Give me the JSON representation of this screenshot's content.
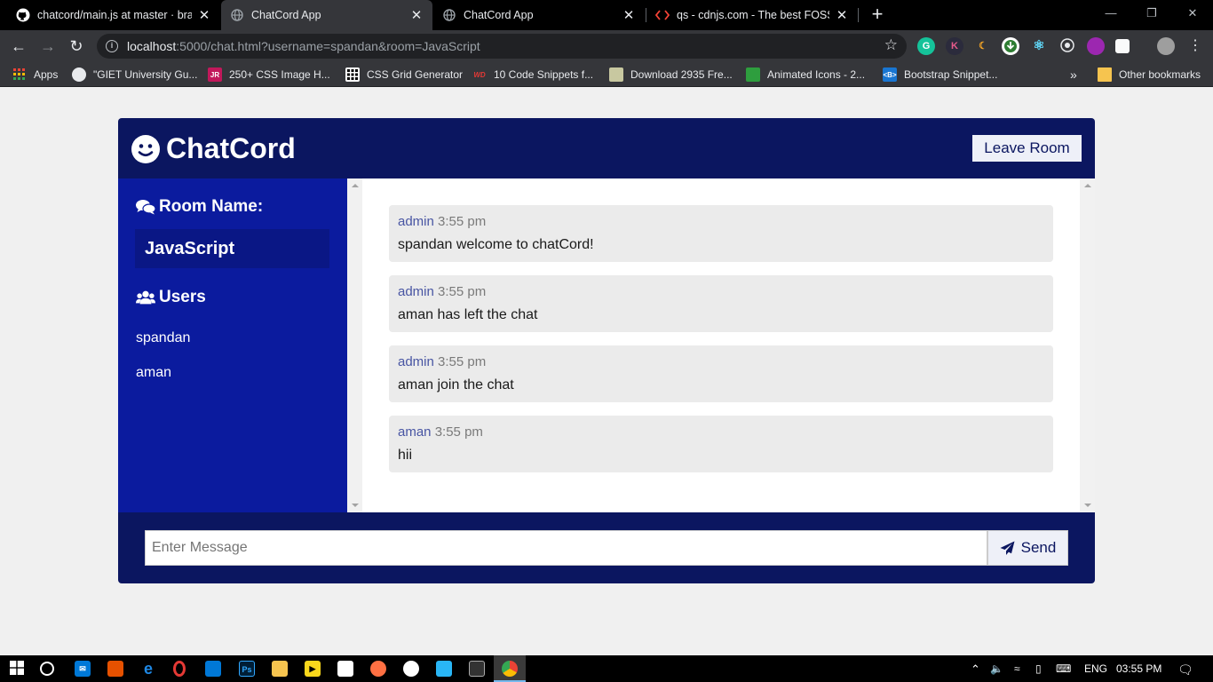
{
  "browser": {
    "tabs": [
      {
        "title": "chatcord/main.js at master · brad",
        "active": false
      },
      {
        "title": "ChatCord App",
        "active": true
      },
      {
        "title": "ChatCord App",
        "active": false
      },
      {
        "title": "qs - cdnjs.com - The best FOSS C",
        "active": false
      }
    ],
    "close_glyph": "✕",
    "new_tab_glyph": "+",
    "url_host": "localhost",
    "url_rest": ":5000/chat.html?username=spandan&room=JavaScript",
    "bookmarks": [
      {
        "label": "Apps",
        "color": "#e8710a"
      },
      {
        "label": "\"GIET University Gu...",
        "color": "#5f6368"
      },
      {
        "label": "250+ CSS Image H...",
        "color": "#c2185b"
      },
      {
        "label": "CSS Grid Generator",
        "color": "#202124"
      },
      {
        "label": "10 Code Snippets f...",
        "color": "#d32f2f"
      },
      {
        "label": "Download 2935 Fre...",
        "color": "#8d8d6a"
      },
      {
        "label": "Animated Icons - 2...",
        "color": "#2e9e3e"
      },
      {
        "label": "Bootstrap Snippet...",
        "color": "#1976d2"
      }
    ],
    "bookmarks_overflow": "»",
    "other_bookmarks": "Other bookmarks"
  },
  "app": {
    "brand": "ChatCord",
    "leave_label": "Leave Room",
    "room_heading": "Room Name:",
    "room_name": "JavaScript",
    "users_heading": "Users",
    "users": [
      "spandan",
      "aman"
    ],
    "messages": [
      {
        "author": "admin",
        "time": "3:55 pm",
        "text": "spandan welcome to chatCord!"
      },
      {
        "author": "admin",
        "time": "3:55 pm",
        "text": "aman has left the chat"
      },
      {
        "author": "admin",
        "time": "3:55 pm",
        "text": "aman join the chat"
      },
      {
        "author": "aman",
        "time": "3:55 pm",
        "text": "hii"
      }
    ],
    "input_placeholder": "Enter Message",
    "send_label": "Send"
  },
  "taskbar": {
    "lang": "ENG",
    "clock": "03:55 PM"
  },
  "colors": {
    "header": "#0b1660",
    "sidebar": "#0b1b9e",
    "room_box": "#0a1785",
    "author": "#4855a3"
  }
}
